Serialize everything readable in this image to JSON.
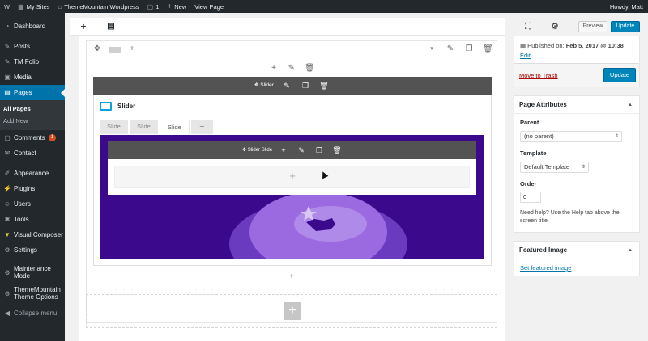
{
  "adminbar": {
    "wp_logo": "W",
    "my_sites": "My Sites",
    "site_name": "ThemeMountain Wordpress",
    "comments_count": "1",
    "new_label": "New",
    "view_page": "View Page",
    "howdy": "Howdy, Matt"
  },
  "sidebar": {
    "dashboard": "Dashboard",
    "posts": "Posts",
    "tm_folio": "TM Folio",
    "media": "Media",
    "pages": "Pages",
    "all_pages": "All Pages",
    "add_new": "Add New",
    "comments": "Comments",
    "comments_badge": "1",
    "contact": "Contact",
    "appearance": "Appearance",
    "plugins": "Plugins",
    "users": "Users",
    "tools": "Tools",
    "visual_composer": "Visual Composer",
    "settings": "Settings",
    "maintenance_1": "Maintenance",
    "maintenance_2": "Mode",
    "tm_options_1": "ThemeMountain",
    "tm_options_2": "Theme Options",
    "collapse": "Collapse menu"
  },
  "toolbar": {
    "add_icon": "+",
    "templates_icon": "▤",
    "fullscreen_icon": "⛶",
    "settings_icon": "⚙",
    "preview": "Preview",
    "update": "Update"
  },
  "canvas": {
    "slider_label": "Slider",
    "slider_title": "Slider",
    "tabs": [
      "Slide",
      "Slide",
      "Slide"
    ],
    "add_tab": "+",
    "slide_label": "Slider Slide"
  },
  "publish": {
    "published_label": "Published on:",
    "published_date": "Feb 5, 2017 @ 10:38",
    "edit": "Edit",
    "move_to_trash": "Move to Trash",
    "update": "Update"
  },
  "page_attributes": {
    "title": "Page Attributes",
    "parent_label": "Parent",
    "parent_value": "(no parent)",
    "template_label": "Template",
    "template_value": "Default Template",
    "order_label": "Order",
    "order_value": "0",
    "help": "Need help? Use the Help tab above the screen title."
  },
  "featured_image": {
    "title": "Featured Image",
    "link": "Set featured image"
  },
  "colors": {
    "admin_dark": "#23282d",
    "accent_blue": "#0073aa",
    "slide_purple": "#3b0a8c",
    "bar_gray": "#535353"
  }
}
